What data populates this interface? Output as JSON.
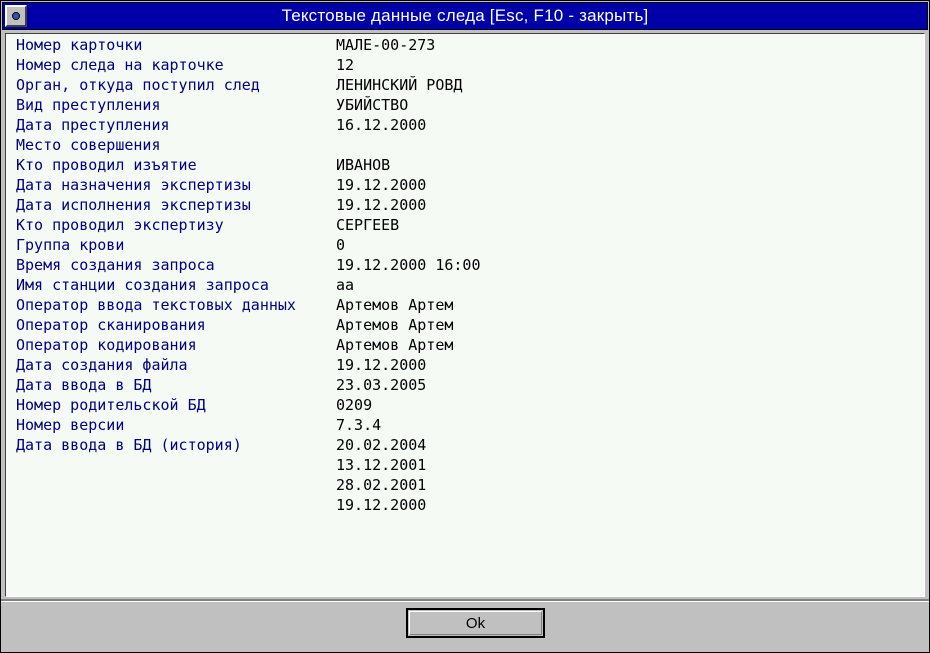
{
  "window": {
    "title": "Текстовые данные следа   [Esc, F10 - закрыть]"
  },
  "fields": [
    {
      "label": "Номер карточки",
      "value": "МАЛЕ-00-273"
    },
    {
      "label": "Номер следа на карточке",
      "value": "12"
    },
    {
      "label": "Орган, откуда поступил след",
      "value": "ЛЕНИНСКИЙ РОВД"
    },
    {
      "label": "Вид преступления",
      "value": "УБИЙСТВО"
    },
    {
      "label": "Дата преступления",
      "value": "16.12.2000"
    },
    {
      "label": "Место совершения",
      "value": ""
    },
    {
      "label": "Кто проводил изъятие",
      "value": "ИВАНОВ"
    },
    {
      "label": "Дата назначения экспертизы",
      "value": "19.12.2000"
    },
    {
      "label": "Дата исполнения экспертизы",
      "value": "19.12.2000"
    },
    {
      "label": "Кто проводил экспертизу",
      "value": "СЕРГЕЕВ"
    },
    {
      "label": "Группа крови",
      "value": "0"
    },
    {
      "label": "Время создания запроса",
      "value": "19.12.2000 16:00"
    },
    {
      "label": "Имя станции создания запроса",
      "value": "aa"
    },
    {
      "label": "Оператор ввода текстовых данных",
      "value": "Артемов Артем"
    },
    {
      "label": "Оператор сканирования",
      "value": "Артемов Артем"
    },
    {
      "label": "Оператор кодирования",
      "value": "Артемов Артем"
    },
    {
      "label": "Дата создания файла",
      "value": "19.12.2000"
    },
    {
      "label": "Дата ввода в БД",
      "value": "23.03.2005"
    },
    {
      "label": "Номер родительской БД",
      "value": "0209"
    },
    {
      "label": "Номер версии",
      "value": "7.3.4"
    },
    {
      "label": "Дата ввода в БД (история)",
      "value": "20.02.2004"
    },
    {
      "label": "",
      "value": "13.12.2001"
    },
    {
      "label": "",
      "value": "28.02.2001"
    },
    {
      "label": "",
      "value": "19.12.2000"
    }
  ],
  "buttons": {
    "ok_label": "Ok"
  }
}
